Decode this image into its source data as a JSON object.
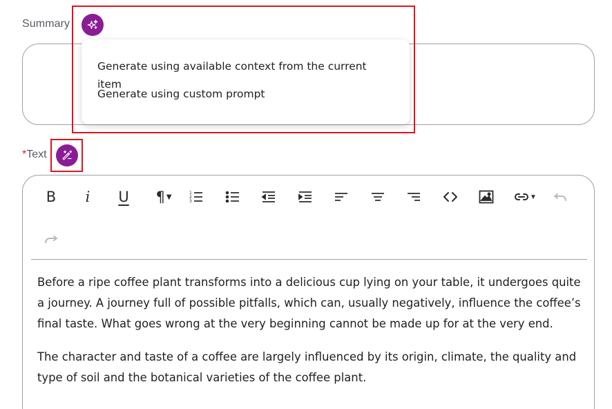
{
  "summary": {
    "label": "Summary",
    "ai_button_icon": "sparkles-icon",
    "value": ""
  },
  "ai_menu": {
    "items": [
      "Generate using available context from the current item",
      "Generate using custom prompt"
    ]
  },
  "text_field": {
    "required_marker": "*",
    "label": "Text",
    "ai_button_icon": "magic-wand-icon",
    "paragraphs": [
      "Before a ripe coffee plant transforms into a delicious cup lying on your table, it undergoes quite a journey. A journey full of possible pitfalls, which can, usually negatively, influence the coffee’s final taste. What goes wrong at the very beginning cannot be made up for at the very end.",
      "The character and taste of a coffee are largely influenced by its origin, climate, the quality and type of soil and the botanical varieties of the coffee plant."
    ]
  },
  "toolbar": {
    "bold": "B",
    "italic": "i",
    "underline": "U",
    "paragraph": "¶",
    "icons": [
      "bold-icon",
      "italic-icon",
      "underline-icon",
      "paragraph-icon",
      "numbered-list-icon",
      "bulleted-list-icon",
      "outdent-icon",
      "indent-icon",
      "align-left-icon",
      "align-center-icon",
      "align-right-icon",
      "code-icon",
      "image-icon",
      "link-icon",
      "undo-icon",
      "redo-icon"
    ]
  },
  "colors": {
    "ai_purple": "#8a1c96",
    "highlight_red": "#e0141c",
    "required_red": "#d0202a"
  }
}
